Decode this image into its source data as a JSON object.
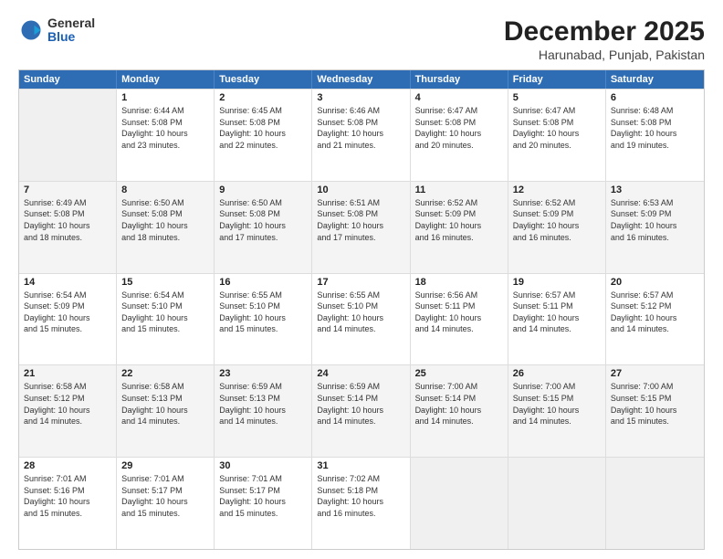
{
  "logo": {
    "general": "General",
    "blue": "Blue"
  },
  "title": "December 2025",
  "subtitle": "Harunabad, Punjab, Pakistan",
  "header_days": [
    "Sunday",
    "Monday",
    "Tuesday",
    "Wednesday",
    "Thursday",
    "Friday",
    "Saturday"
  ],
  "weeks": [
    [
      {
        "day": "",
        "info": ""
      },
      {
        "day": "1",
        "info": "Sunrise: 6:44 AM\nSunset: 5:08 PM\nDaylight: 10 hours\nand 23 minutes."
      },
      {
        "day": "2",
        "info": "Sunrise: 6:45 AM\nSunset: 5:08 PM\nDaylight: 10 hours\nand 22 minutes."
      },
      {
        "day": "3",
        "info": "Sunrise: 6:46 AM\nSunset: 5:08 PM\nDaylight: 10 hours\nand 21 minutes."
      },
      {
        "day": "4",
        "info": "Sunrise: 6:47 AM\nSunset: 5:08 PM\nDaylight: 10 hours\nand 20 minutes."
      },
      {
        "day": "5",
        "info": "Sunrise: 6:47 AM\nSunset: 5:08 PM\nDaylight: 10 hours\nand 20 minutes."
      },
      {
        "day": "6",
        "info": "Sunrise: 6:48 AM\nSunset: 5:08 PM\nDaylight: 10 hours\nand 19 minutes."
      }
    ],
    [
      {
        "day": "7",
        "info": "Sunrise: 6:49 AM\nSunset: 5:08 PM\nDaylight: 10 hours\nand 18 minutes."
      },
      {
        "day": "8",
        "info": "Sunrise: 6:50 AM\nSunset: 5:08 PM\nDaylight: 10 hours\nand 18 minutes."
      },
      {
        "day": "9",
        "info": "Sunrise: 6:50 AM\nSunset: 5:08 PM\nDaylight: 10 hours\nand 17 minutes."
      },
      {
        "day": "10",
        "info": "Sunrise: 6:51 AM\nSunset: 5:08 PM\nDaylight: 10 hours\nand 17 minutes."
      },
      {
        "day": "11",
        "info": "Sunrise: 6:52 AM\nSunset: 5:09 PM\nDaylight: 10 hours\nand 16 minutes."
      },
      {
        "day": "12",
        "info": "Sunrise: 6:52 AM\nSunset: 5:09 PM\nDaylight: 10 hours\nand 16 minutes."
      },
      {
        "day": "13",
        "info": "Sunrise: 6:53 AM\nSunset: 5:09 PM\nDaylight: 10 hours\nand 16 minutes."
      }
    ],
    [
      {
        "day": "14",
        "info": "Sunrise: 6:54 AM\nSunset: 5:09 PM\nDaylight: 10 hours\nand 15 minutes."
      },
      {
        "day": "15",
        "info": "Sunrise: 6:54 AM\nSunset: 5:10 PM\nDaylight: 10 hours\nand 15 minutes."
      },
      {
        "day": "16",
        "info": "Sunrise: 6:55 AM\nSunset: 5:10 PM\nDaylight: 10 hours\nand 15 minutes."
      },
      {
        "day": "17",
        "info": "Sunrise: 6:55 AM\nSunset: 5:10 PM\nDaylight: 10 hours\nand 14 minutes."
      },
      {
        "day": "18",
        "info": "Sunrise: 6:56 AM\nSunset: 5:11 PM\nDaylight: 10 hours\nand 14 minutes."
      },
      {
        "day": "19",
        "info": "Sunrise: 6:57 AM\nSunset: 5:11 PM\nDaylight: 10 hours\nand 14 minutes."
      },
      {
        "day": "20",
        "info": "Sunrise: 6:57 AM\nSunset: 5:12 PM\nDaylight: 10 hours\nand 14 minutes."
      }
    ],
    [
      {
        "day": "21",
        "info": "Sunrise: 6:58 AM\nSunset: 5:12 PM\nDaylight: 10 hours\nand 14 minutes."
      },
      {
        "day": "22",
        "info": "Sunrise: 6:58 AM\nSunset: 5:13 PM\nDaylight: 10 hours\nand 14 minutes."
      },
      {
        "day": "23",
        "info": "Sunrise: 6:59 AM\nSunset: 5:13 PM\nDaylight: 10 hours\nand 14 minutes."
      },
      {
        "day": "24",
        "info": "Sunrise: 6:59 AM\nSunset: 5:14 PM\nDaylight: 10 hours\nand 14 minutes."
      },
      {
        "day": "25",
        "info": "Sunrise: 7:00 AM\nSunset: 5:14 PM\nDaylight: 10 hours\nand 14 minutes."
      },
      {
        "day": "26",
        "info": "Sunrise: 7:00 AM\nSunset: 5:15 PM\nDaylight: 10 hours\nand 14 minutes."
      },
      {
        "day": "27",
        "info": "Sunrise: 7:00 AM\nSunset: 5:15 PM\nDaylight: 10 hours\nand 15 minutes."
      }
    ],
    [
      {
        "day": "28",
        "info": "Sunrise: 7:01 AM\nSunset: 5:16 PM\nDaylight: 10 hours\nand 15 minutes."
      },
      {
        "day": "29",
        "info": "Sunrise: 7:01 AM\nSunset: 5:17 PM\nDaylight: 10 hours\nand 15 minutes."
      },
      {
        "day": "30",
        "info": "Sunrise: 7:01 AM\nSunset: 5:17 PM\nDaylight: 10 hours\nand 15 minutes."
      },
      {
        "day": "31",
        "info": "Sunrise: 7:02 AM\nSunset: 5:18 PM\nDaylight: 10 hours\nand 16 minutes."
      },
      {
        "day": "",
        "info": ""
      },
      {
        "day": "",
        "info": ""
      },
      {
        "day": "",
        "info": ""
      }
    ]
  ]
}
